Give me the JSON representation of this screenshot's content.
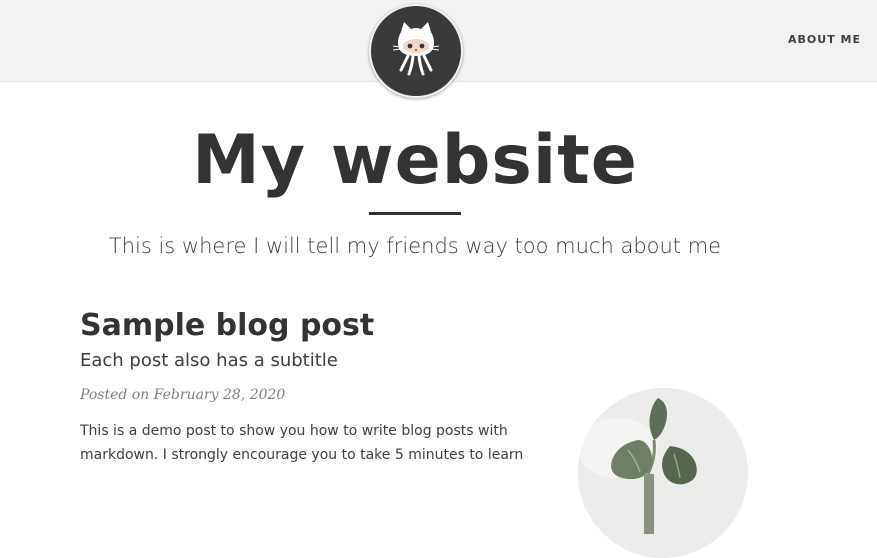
{
  "navbar": {
    "links": [
      {
        "label": "ABOUT ME"
      }
    ],
    "avatar_icon": "github-octocat-icon"
  },
  "header": {
    "title": "My website",
    "subtitle": "This is where I will tell my friends way too much about me"
  },
  "posts": [
    {
      "title": "Sample blog post",
      "subtitle": "Each post also has a subtitle",
      "meta": "Posted on February 28, 2020",
      "excerpt": "This is a demo post to show you how to write blog posts with markdown. I strongly encourage you to take 5 minutes to learn",
      "thumbnail_icon": "plant-leaf-photo"
    }
  ],
  "colors": {
    "navbar_bg": "#f2f2f2",
    "text_dark": "#333333",
    "text": "#404040",
    "meta": "#808080"
  }
}
